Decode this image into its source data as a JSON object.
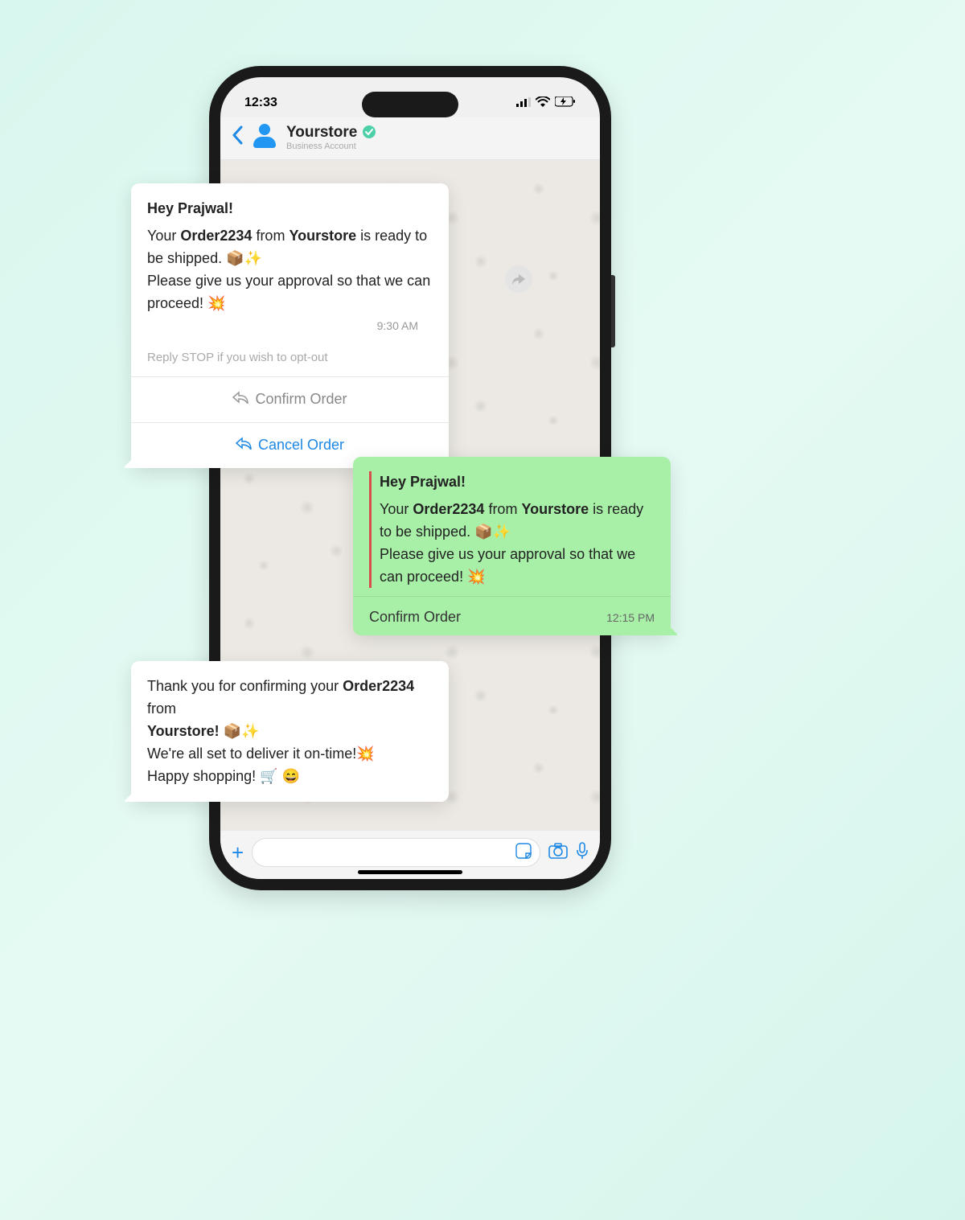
{
  "status": {
    "time": "12:33"
  },
  "header": {
    "name": "Yourstore",
    "subtitle": "Business Account"
  },
  "msg1": {
    "greeting": "Hey Prajwal!",
    "l1a": "Your ",
    "l1b": "Order2234",
    "l1c": " from ",
    "l1d": "Yourstore",
    "l1e": " is ready to be shipped. 📦✨",
    "l2": "Please give us your approval so that we can proceed! 💥",
    "time": "9:30 AM",
    "optout": "Reply STOP if you wish to opt-out",
    "action_confirm": "Confirm Order",
    "action_cancel": "Cancel Order"
  },
  "msg2": {
    "greeting": "Hey Prajwal!",
    "l1a": "Your ",
    "l1b": "Order2234",
    "l1c": " from ",
    "l1d": "Yourstore",
    "l1e": " is ready to be shipped. 📦✨",
    "l2": "Please give us your approval so that we can proceed! 💥",
    "selected": "Confirm Order",
    "time": "12:15 PM"
  },
  "msg3": {
    "l1a": "Thank you for confirming your ",
    "l1b": "Order2234",
    "l1c": " from ",
    "l2a": "Yourstore!",
    "l2b": " 📦✨",
    "l3": "We're all set to deliver it on-time!💥",
    "l4": "Happy shopping! 🛒 😄"
  }
}
